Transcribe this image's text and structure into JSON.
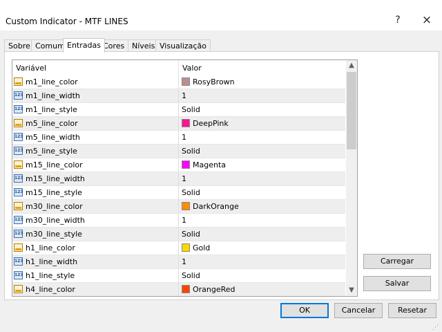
{
  "window": {
    "title": "Custom Indicator - MTF LINES",
    "help_glyph": "?",
    "close_glyph": "×"
  },
  "tabs": [
    "Sobre",
    "Comum",
    "Entradas",
    "Cores",
    "Níveis",
    "Visualização"
  ],
  "active_tab": "Entradas",
  "grid": {
    "headers": {
      "variable": "Variável",
      "value": "Valor"
    },
    "rows": [
      {
        "name": "m1_line_color",
        "type": "color",
        "value": "RosyBrown",
        "color": "#bc8f8f"
      },
      {
        "name": "m1_line_width",
        "type": "int",
        "value": "1"
      },
      {
        "name": "m1_line_style",
        "type": "int",
        "value": "Solid"
      },
      {
        "name": "m5_line_color",
        "type": "color",
        "value": "DeepPink",
        "color": "#ff1493"
      },
      {
        "name": "m5_line_width",
        "type": "int",
        "value": "1"
      },
      {
        "name": "m5_line_style",
        "type": "int",
        "value": "Solid"
      },
      {
        "name": "m15_line_color",
        "type": "color",
        "value": "Magenta",
        "color": "#ff00ff"
      },
      {
        "name": "m15_line_width",
        "type": "int",
        "value": "1"
      },
      {
        "name": "m15_line_style",
        "type": "int",
        "value": "Solid"
      },
      {
        "name": "m30_line_color",
        "type": "color",
        "value": "DarkOrange",
        "color": "#ff8c00"
      },
      {
        "name": "m30_line_width",
        "type": "int",
        "value": "1"
      },
      {
        "name": "m30_line_style",
        "type": "int",
        "value": "Solid"
      },
      {
        "name": "h1_line_color",
        "type": "color",
        "value": "Gold",
        "color": "#ffd700"
      },
      {
        "name": "h1_line_width",
        "type": "int",
        "value": "1"
      },
      {
        "name": "h1_line_style",
        "type": "int",
        "value": "Solid"
      },
      {
        "name": "h4_line_color",
        "type": "color",
        "value": "OrangeRed",
        "color": "#ff4500"
      }
    ],
    "int_icon_text": "123"
  },
  "side_buttons": {
    "load": "Carregar",
    "save": "Salvar"
  },
  "footer_buttons": {
    "ok": "OK",
    "cancel": "Cancelar",
    "reset": "Resetar"
  },
  "colors": {
    "accent": "#0078d7"
  }
}
